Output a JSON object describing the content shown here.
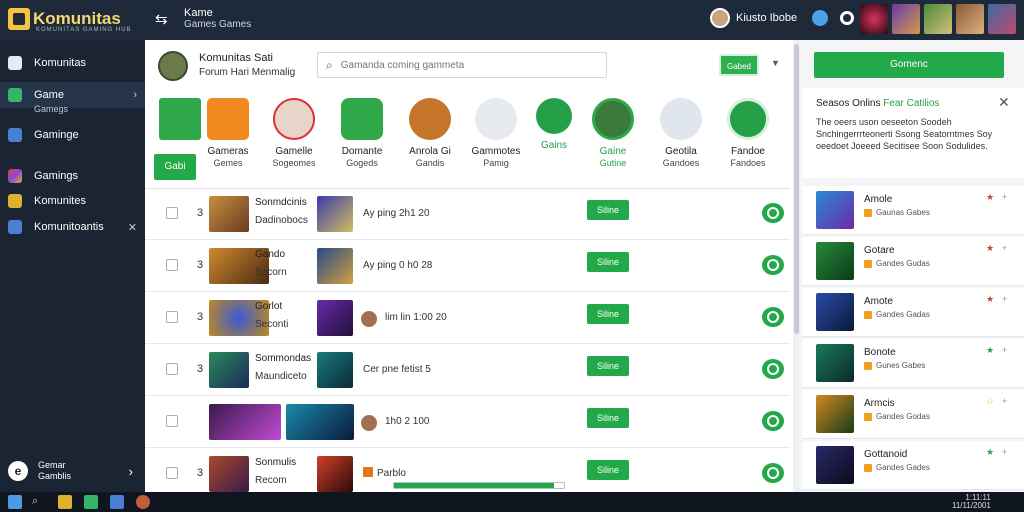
{
  "app": {
    "name": "Komunitas",
    "tagline": "KOMUNITAS GAMING HUB"
  },
  "topnav": {
    "title": "Kame",
    "subtitle": "Games Games",
    "user_name": "Kiusto Ibobe"
  },
  "sidebar": {
    "items": [
      {
        "label": "Komunitas"
      },
      {
        "label": "Game",
        "sub": "Gamegs"
      },
      {
        "label": "Gaminge"
      },
      {
        "label": "Gamings"
      },
      {
        "label": "Komunites"
      },
      {
        "label": "Komunitoantis"
      }
    ],
    "footer": {
      "line1": "Gemar",
      "line2": "Gamblis"
    }
  },
  "main": {
    "title": "Komunitas Sati",
    "subtitle": "Forum Hari Menmalig",
    "search_placeholder": "Gamanda coming gammeta",
    "top_button": "Gabed",
    "filter_label": "Gabi",
    "categories": [
      {
        "label": "",
        "sub": ""
      },
      {
        "label": "Gameras",
        "sub": "Gemes"
      },
      {
        "label": "Gamelle",
        "sub": "Sogeomes"
      },
      {
        "label": "Domante",
        "sub": "Gogeds"
      },
      {
        "label": "Anrola Gi",
        "sub": "Gandis"
      },
      {
        "label": "Gammotes",
        "sub": "Pamig"
      },
      {
        "label": "Gains",
        "sub": ""
      },
      {
        "label": "Gaine",
        "sub": "Gutine"
      },
      {
        "label": "Geotila",
        "sub": "Gandoes"
      },
      {
        "label": "Fandoe",
        "sub": "Fandoes"
      }
    ],
    "rows": [
      {
        "num": "3",
        "name": "Sonmdcinis",
        "meta": "Dadinobocs",
        "stat": "Ay ping 2h1 20",
        "pill": "Siline"
      },
      {
        "num": "3",
        "name": "Gando",
        "meta": "Secorn",
        "stat": "Ay ping 0 h0 28",
        "pill": "Siline"
      },
      {
        "num": "3",
        "name": "Gorlot",
        "meta": "Seconti",
        "stat": "lim lin 1:00 20",
        "pill": "Siline"
      },
      {
        "num": "3",
        "name": "Sommondas",
        "meta": "Maundiceto",
        "stat": "Cer pne fetist 5",
        "pill": "Siline"
      },
      {
        "num": "",
        "name": "",
        "meta": "",
        "stat": "1h0 2 100",
        "pill": "Siline"
      },
      {
        "num": "3",
        "name": "Sonmulis",
        "meta": "Recom",
        "stat": "Parblo",
        "pill": "Siline"
      }
    ],
    "progress": 0.94
  },
  "rpanel": {
    "button": "Gomenc",
    "card_title": "Seasos Onlins",
    "card_title_accent": "Fear Catilios",
    "card_body": "The oeers uson oeseeton Soodeh Snchingerrrteonerti Ssong Seatorntmes Soy oeedoet Joeeed Secitisee Soon Sodulides.",
    "items": [
      {
        "name": "Amole",
        "sub": "Gaunas Gabes",
        "star": "★",
        "star_color": "#c2453a"
      },
      {
        "name": "Gotare",
        "sub": "Gandes Gudas",
        "star": "★",
        "star_color": "#c2453a"
      },
      {
        "name": "Amote",
        "sub": "Gandes Gadas",
        "star": "★",
        "star_color": "#c2453a"
      },
      {
        "name": "Bonote",
        "sub": "Gunes Gabes",
        "star": "★",
        "star_color": "#27a24a"
      },
      {
        "name": "Armcis",
        "sub": "Gandes Godas",
        "star": "☆",
        "star_color": "#e0c040"
      },
      {
        "name": "Gottanoid",
        "sub": "Gandes Gades",
        "star": "★",
        "star_color": "#27a24a"
      }
    ]
  },
  "taskbar": {
    "time": "1:11:11",
    "date": "11/11/2001"
  }
}
